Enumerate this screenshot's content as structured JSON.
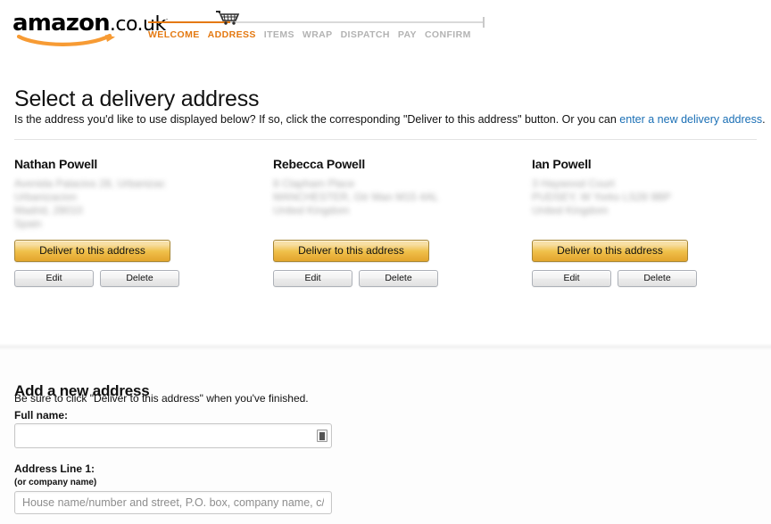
{
  "brand": {
    "logo_main": "amazon",
    "logo_suffix": ".co.uk",
    "logo_tm": "·",
    "accent_color": "#e47911",
    "link_color": "#1a6fb5"
  },
  "progress": {
    "icon": "shopping-cart-icon",
    "steps": [
      {
        "label": "WELCOME",
        "state": "done"
      },
      {
        "label": "ADDRESS",
        "state": "active"
      },
      {
        "label": "ITEMS",
        "state": "todo"
      },
      {
        "label": "WRAP",
        "state": "todo"
      },
      {
        "label": "DISPATCH",
        "state": "todo"
      },
      {
        "label": "PAY",
        "state": "todo"
      },
      {
        "label": "CONFIRM",
        "state": "todo"
      }
    ]
  },
  "page": {
    "title": "Select a delivery address",
    "intro_before": "Is the address you'd like to use displayed below? If so, click the corresponding \"Deliver to this address\" button. Or you can ",
    "intro_link": "enter a new delivery address",
    "intro_after": "."
  },
  "addresses": [
    {
      "name": "Nathan Powell",
      "lines": [
        "Avenida Palacios 28, Urbanizac",
        "Urbanizacion",
        "Madrid, 28010",
        "Spain"
      ],
      "deliver_label": "Deliver to this address",
      "edit_label": "Edit",
      "delete_label": "Delete"
    },
    {
      "name": "Rebecca Powell",
      "lines": [
        "8 Clapham Place",
        "MANCHESTER, Gtr Man M15 4AL",
        "United Kingdom"
      ],
      "deliver_label": "Deliver to this address",
      "edit_label": "Edit",
      "delete_label": "Delete"
    },
    {
      "name": "Ian Powell",
      "lines": [
        "3 Haywood Court",
        "PUDSEY, W Yorks LS28 9BP",
        "United Kingdom"
      ],
      "deliver_label": "Deliver to this address",
      "edit_label": "Edit",
      "delete_label": "Delete"
    }
  ],
  "new_address": {
    "heading": "Add a new address",
    "subtext": "Be sure to click \"Deliver to this address\" when you've finished.",
    "full_name": {
      "label": "Full name:",
      "value": "",
      "placeholder": "",
      "autofill_icon": "contact-card-icon"
    },
    "address_line_1": {
      "label": "Address Line 1:",
      "sublabel": "(or company name)",
      "value": "",
      "placeholder": "House name/number and street, P.O. box, company name, c/o"
    }
  }
}
